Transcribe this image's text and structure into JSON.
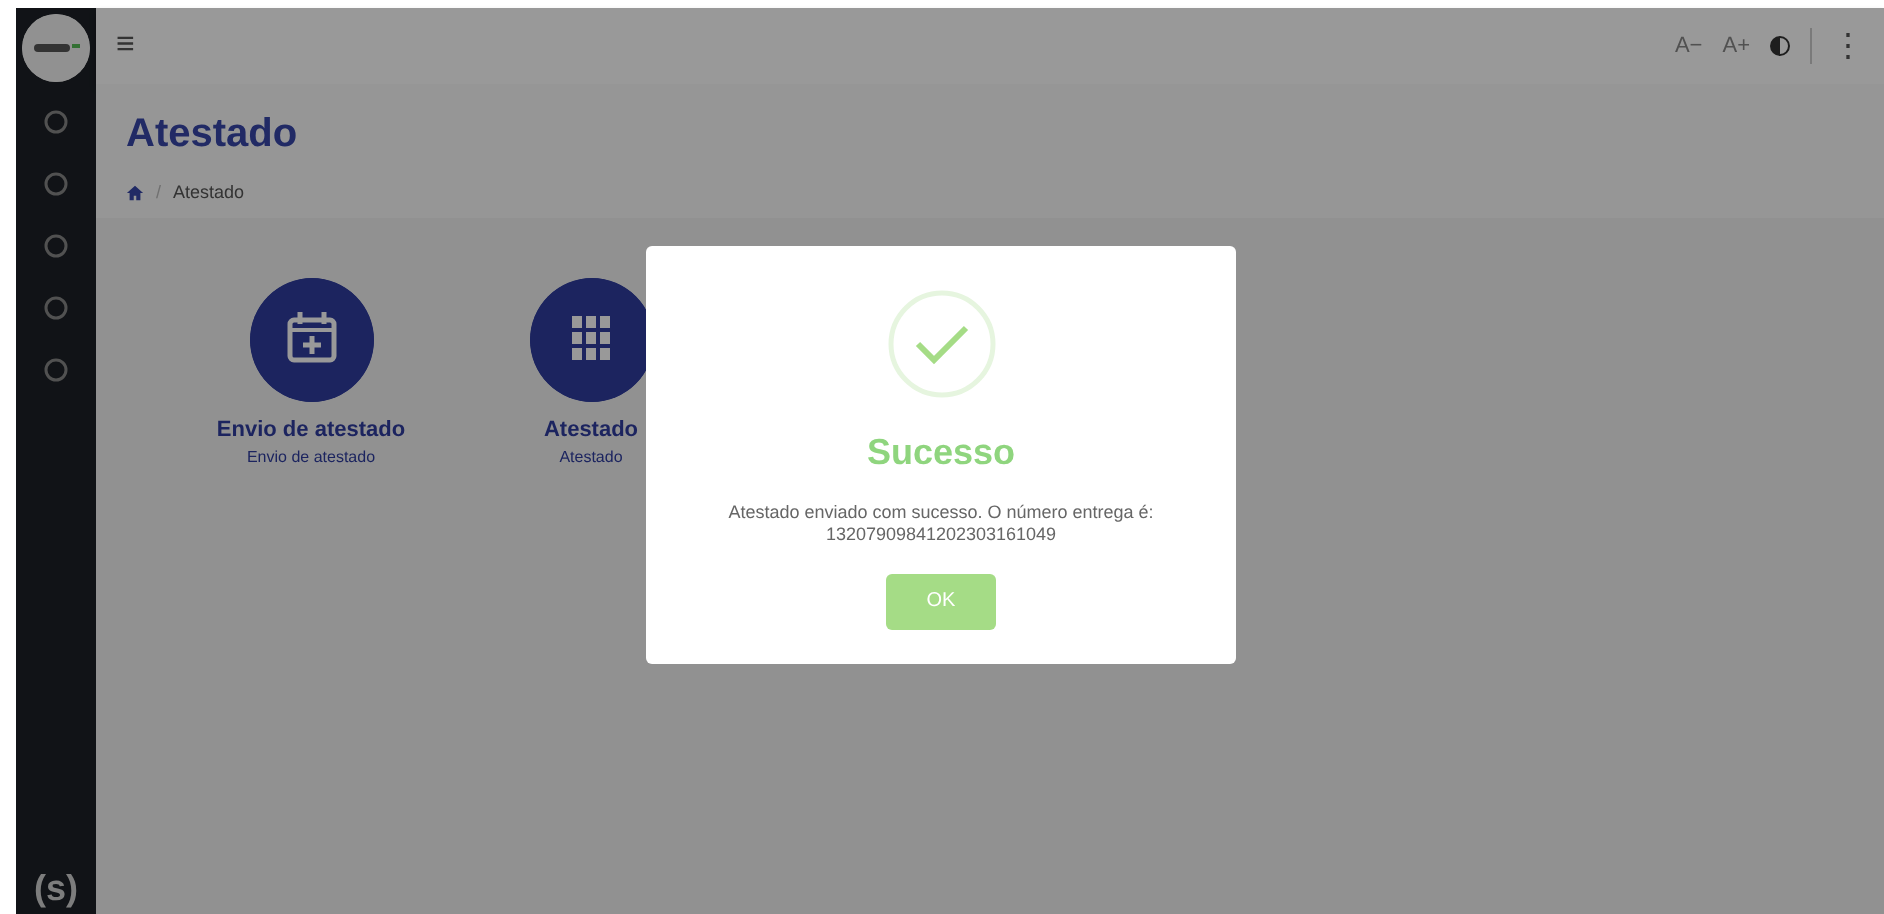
{
  "topbar": {
    "menu_glyph": "≡",
    "font_decrease": "A−",
    "font_increase": "A+",
    "more_glyph": "⋮"
  },
  "sidebar": {
    "footer_logo": "(s)"
  },
  "page": {
    "title": "Atestado",
    "breadcrumb_separator": "/",
    "breadcrumb": "Atestado"
  },
  "cards": [
    {
      "kind": "calendar",
      "title": "Envio de atestado",
      "subtitle": "Envio de atestado"
    },
    {
      "kind": "grid",
      "title": "Atestado",
      "subtitle": "Atestado"
    }
  ],
  "modal": {
    "title": "Sucesso",
    "message": "Atestado enviado com sucesso. O número entrega é:",
    "number": "13207909841202303161049",
    "button": "OK"
  }
}
